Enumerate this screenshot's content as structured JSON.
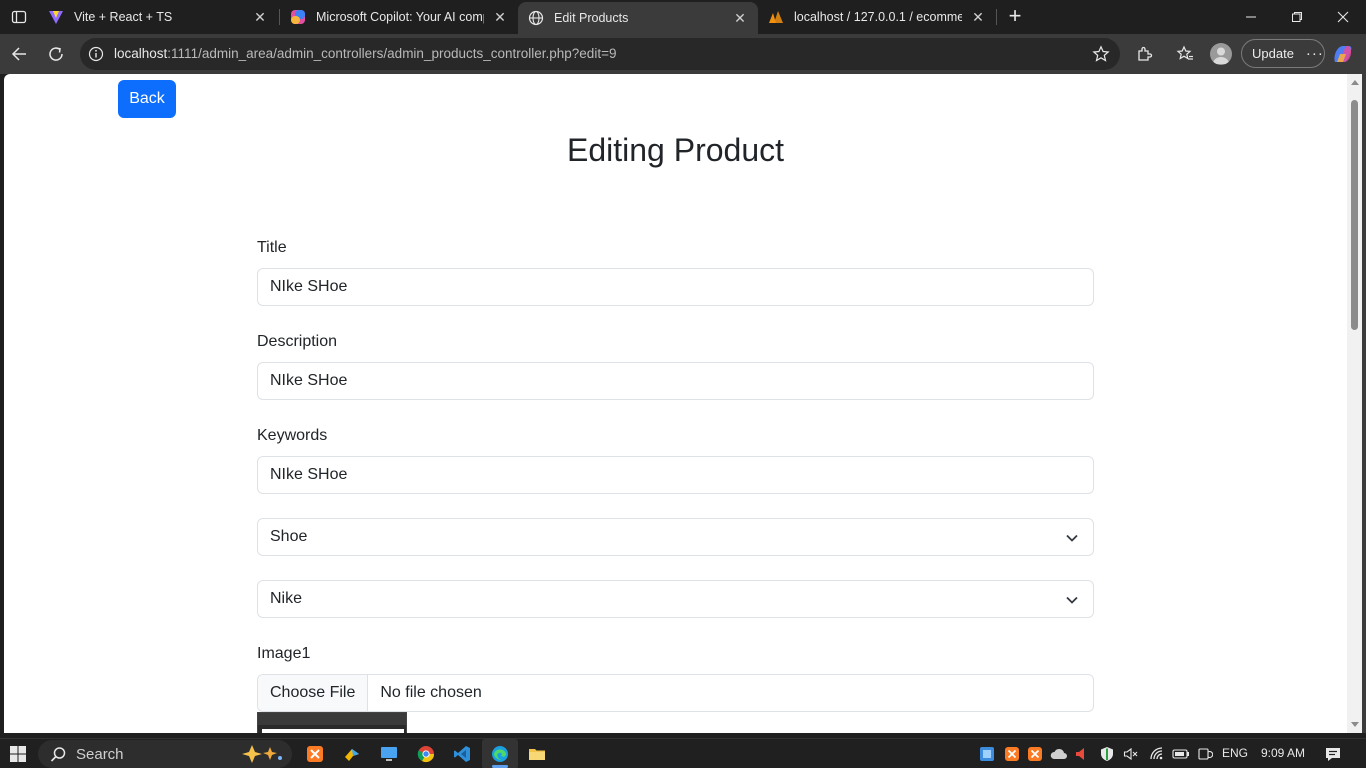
{
  "browser": {
    "tabs": [
      {
        "title": "Vite + React + TS",
        "icon": "vite-icon",
        "active": false
      },
      {
        "title": "Microsoft Copilot: Your AI compa",
        "icon": "copilot-icon",
        "active": false
      },
      {
        "title": "Edit Products",
        "icon": "globe-icon",
        "active": true
      },
      {
        "title": "localhost / 127.0.0.1 / ecommerce",
        "icon": "phpmyadmin-icon",
        "active": false
      }
    ],
    "url_host": "localhost",
    "url_path": ":1111/admin_area/admin_controllers/admin_products_controller.php?edit=9",
    "update_label": "Update"
  },
  "page": {
    "back_label": "Back",
    "heading": "Editing Product",
    "title_label": "Title",
    "title_value": "NIke SHoe",
    "description_label": "Description",
    "description_value": "NIke SHoe",
    "keywords_label": "Keywords",
    "keywords_value": "NIke SHoe",
    "category_selected": "Shoe",
    "brand_selected": "Nike",
    "image1_label": "Image1",
    "choose_file_label": "Choose File",
    "no_file_label": "No file chosen"
  },
  "taskbar": {
    "search_label": "Search",
    "language": "ENG",
    "time": "9:09 AM"
  },
  "colors": {
    "primary": "#0d6efd",
    "browser_chrome": "#3b3b3b",
    "taskbar": "#202020"
  }
}
